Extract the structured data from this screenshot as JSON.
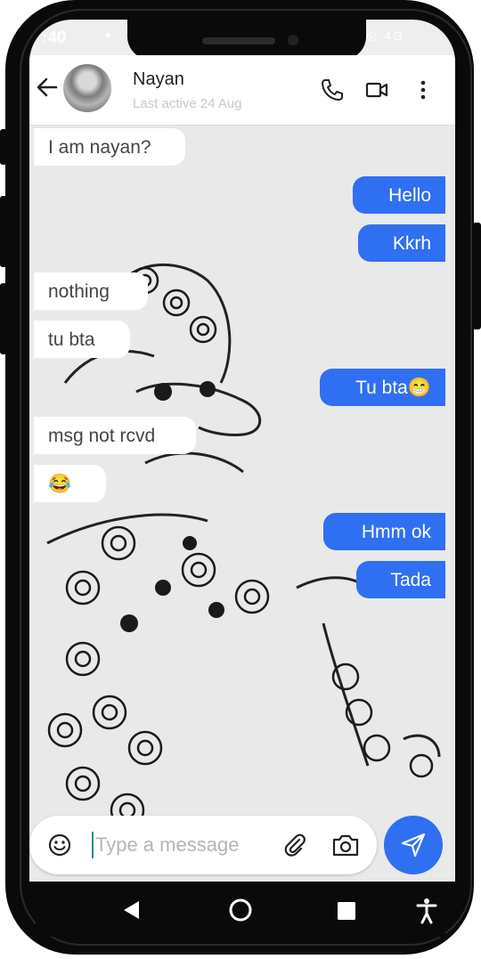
{
  "status_bar": {
    "time": ":40",
    "right_icons": "◎ 4G"
  },
  "header": {
    "contact_name": "Nayan",
    "contact_status": "Last active 24 Aug"
  },
  "messages": [
    {
      "direction": "in",
      "text": "I am nayan?"
    },
    {
      "direction": "out",
      "text": "Hello"
    },
    {
      "direction": "out",
      "text": "Kkrh"
    },
    {
      "direction": "in",
      "text": "nothing"
    },
    {
      "direction": "in",
      "text": "tu bta"
    },
    {
      "direction": "out",
      "text": "Tu bta😁"
    },
    {
      "direction": "in",
      "text": "msg not rcvd"
    },
    {
      "direction": "in",
      "text": "😂"
    },
    {
      "direction": "out",
      "text": "Hmm ok"
    },
    {
      "direction": "out",
      "text": "Tada"
    }
  ],
  "composer": {
    "placeholder": "Type a message",
    "value": ""
  },
  "colors": {
    "accent": "#2f6ff2",
    "incoming_bubble": "#ffffff",
    "header_bg": "#ffffff"
  },
  "icons": {
    "back": "arrow-left-icon",
    "call": "phone-icon",
    "video": "video-camera-icon",
    "menu": "more-vertical-icon",
    "emoji": "smiley-icon",
    "attach": "paperclip-icon",
    "camera": "camera-icon",
    "send": "send-icon"
  },
  "nav_bar": {
    "back": "triangle-back-icon",
    "home": "circle-home-icon",
    "recents": "square-recents-icon",
    "accessibility": "accessibility-icon"
  }
}
